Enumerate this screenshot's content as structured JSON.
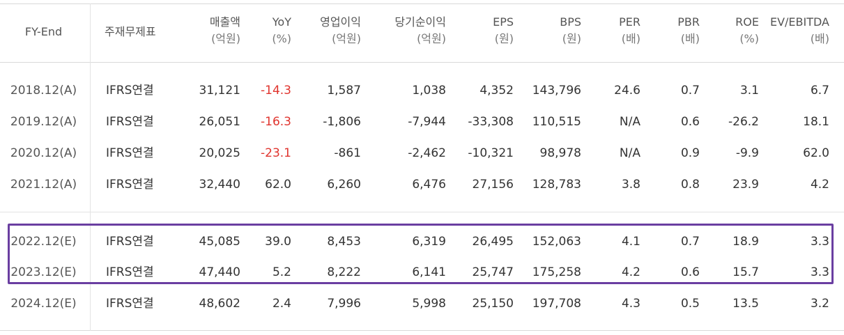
{
  "headers": [
    {
      "line1": "FY-End",
      "line2": ""
    },
    {
      "line1": "주재무제표",
      "line2": ""
    },
    {
      "line1": "매출액",
      "line2": "(억원)"
    },
    {
      "line1": "YoY",
      "line2": "(%)"
    },
    {
      "line1": "영업이익",
      "line2": "(억원)"
    },
    {
      "line1": "당기순이익",
      "line2": "(억원)"
    },
    {
      "line1": "EPS",
      "line2": "(원)"
    },
    {
      "line1": "BPS",
      "line2": "(원)"
    },
    {
      "line1": "PER",
      "line2": "(배)"
    },
    {
      "line1": "PBR",
      "line2": "(배)"
    },
    {
      "line1": "ROE",
      "line2": "(%)"
    },
    {
      "line1": "EV/EBITDA",
      "line2": "(배)"
    }
  ],
  "rows": [
    {
      "fy": "2018.12(A)",
      "type": "IFRS연결",
      "sales": "31,121",
      "yoy": "-14.3",
      "op": "1,587",
      "net": "1,038",
      "eps": "4,352",
      "bps": "143,796",
      "per": "24.6",
      "pbr": "0.7",
      "roe": "3.1",
      "ev": "6.7"
    },
    {
      "fy": "2019.12(A)",
      "type": "IFRS연결",
      "sales": "26,051",
      "yoy": "-16.3",
      "op": "-1,806",
      "net": "-7,944",
      "eps": "-33,308",
      "bps": "110,515",
      "per": "N/A",
      "pbr": "0.6",
      "roe": "-26.2",
      "ev": "18.1"
    },
    {
      "fy": "2020.12(A)",
      "type": "IFRS연결",
      "sales": "20,025",
      "yoy": "-23.1",
      "op": "-861",
      "net": "-2,462",
      "eps": "-10,321",
      "bps": "98,978",
      "per": "N/A",
      "pbr": "0.9",
      "roe": "-9.9",
      "ev": "62.0"
    },
    {
      "fy": "2021.12(A)",
      "type": "IFRS연결",
      "sales": "32,440",
      "yoy": "62.0",
      "op": "6,260",
      "net": "6,476",
      "eps": "27,156",
      "bps": "128,783",
      "per": "3.8",
      "pbr": "0.8",
      "roe": "23.9",
      "ev": "4.2"
    },
    {
      "fy": "2022.12(E)",
      "type": "IFRS연결",
      "sales": "45,085",
      "yoy": "39.0",
      "op": "8,453",
      "net": "6,319",
      "eps": "26,495",
      "bps": "152,063",
      "per": "4.1",
      "pbr": "0.7",
      "roe": "18.9",
      "ev": "3.3"
    },
    {
      "fy": "2023.12(E)",
      "type": "IFRS연결",
      "sales": "47,440",
      "yoy": "5.2",
      "op": "8,222",
      "net": "6,141",
      "eps": "25,747",
      "bps": "175,258",
      "per": "4.2",
      "pbr": "0.6",
      "roe": "15.7",
      "ev": "3.3"
    },
    {
      "fy": "2024.12(E)",
      "type": "IFRS연결",
      "sales": "48,602",
      "yoy": "2.4",
      "op": "7,996",
      "net": "5,998",
      "eps": "25,150",
      "bps": "197,708",
      "per": "4.3",
      "pbr": "0.5",
      "roe": "13.5",
      "ev": "3.2"
    }
  ],
  "colors": {
    "negative_yoy": "#e0342e",
    "highlight_border": "#6a3ea1"
  }
}
